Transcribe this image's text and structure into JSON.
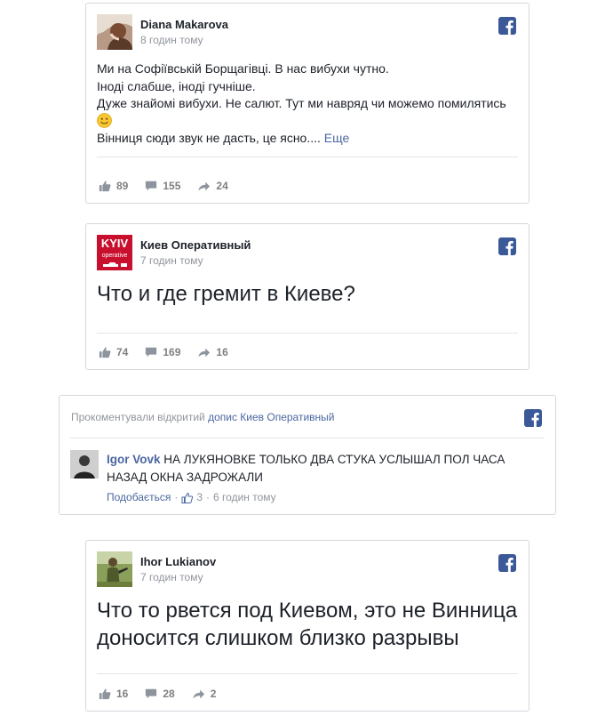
{
  "colors": {
    "facebook_blue": "#3b5998",
    "link_blue": "#4b67a1",
    "meta_gray": "#90949c",
    "text": "#1d2129",
    "kyiv_red": "#c8102e"
  },
  "posts": [
    {
      "author": "Diana Makarova",
      "time": "8 годин тому",
      "avatar_icon": "user-photo-avatar",
      "lines": [
        "Ми на Софіївській Борщагівці. В нас вибухи чутно.",
        "Іноді слабше, іноді гучніше.",
        "Дуже знайомі вибухи. Не салют. Тут ми навряд чи можемо помилятись",
        "Вінниця сюди звук не дасть, це ясно.... "
      ],
      "emoji": "🙂",
      "more": "Еще",
      "likes": "89",
      "comments": "155",
      "shares": "24"
    },
    {
      "author": "Киев Оперативный",
      "time": "7 годин тому",
      "avatar_text_top": "KYIV",
      "avatar_text_bottom": "operative",
      "big_text": "Что и где гремит в Киеве?",
      "likes": "74",
      "comments": "169",
      "shares": "16"
    },
    {
      "author": "Ihor Lukianov",
      "time": "7 годин тому",
      "avatar_icon": "user-photo-avatar",
      "big_lines": [
        "Что то рвется под Киевом, это не Винница",
        "доносится слишком близко разрывы"
      ],
      "likes": "16",
      "comments": "28",
      "shares": "2"
    }
  ],
  "comment_card": {
    "header_prefix": "Прокоментували відкритий",
    "header_link": "допис Киев Оперативный",
    "commenter": "Igor Vovk",
    "text": " НА ЛУКЯНОВКЕ ТОЛЬКО ДВА СТУКА УСЛЫШАЛ ПОЛ ЧАСА НАЗАД ОКНА ЗАДРОЖАЛИ",
    "like_label": "Подобається",
    "dot": "·",
    "like_count": "3",
    "time": "6 годин тому"
  }
}
